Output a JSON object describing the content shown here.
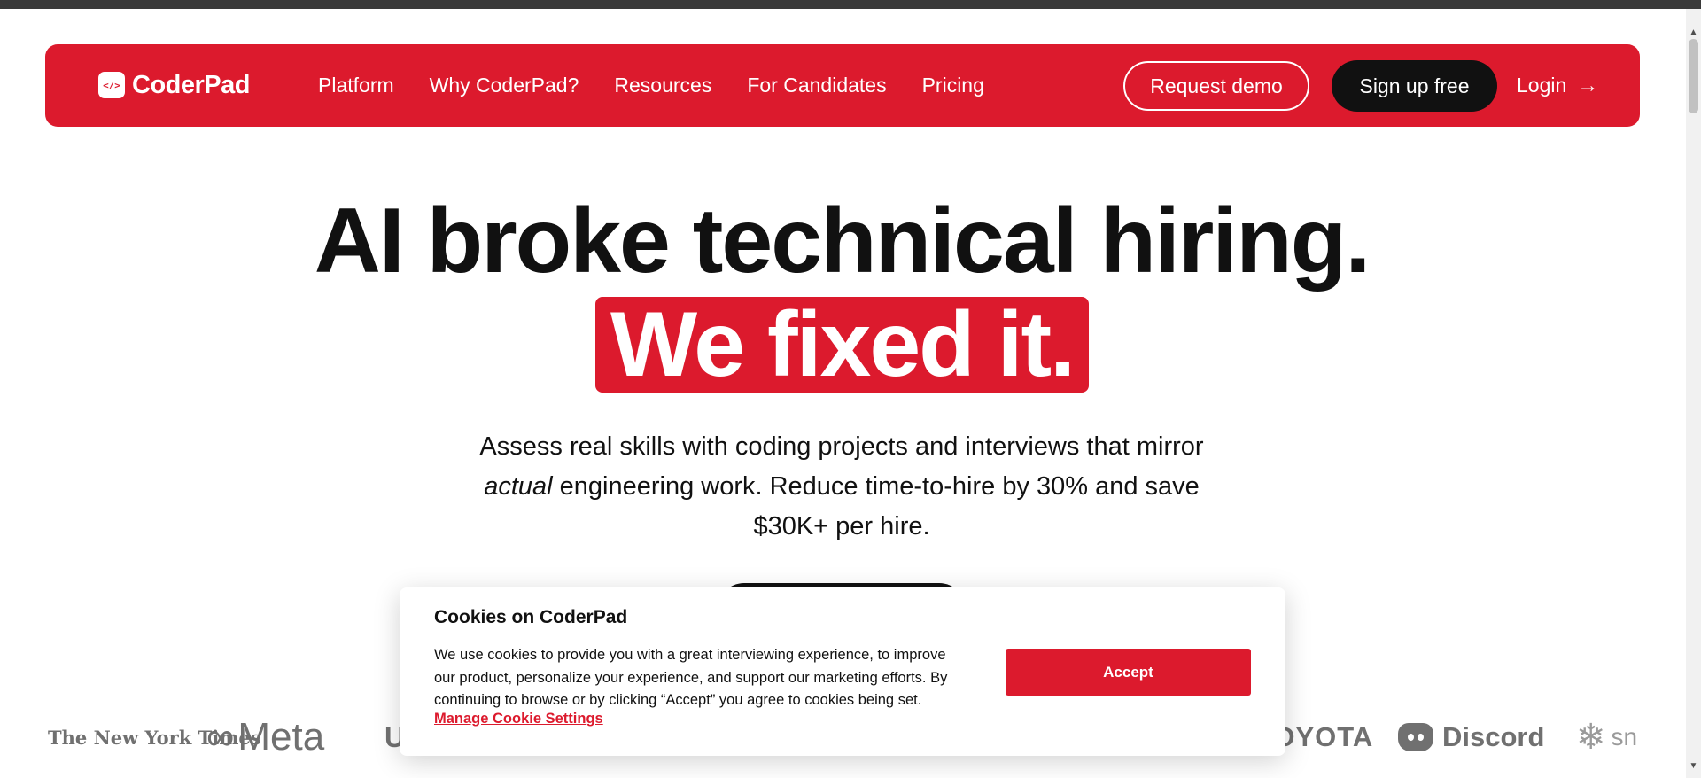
{
  "nav": {
    "logo_mark": "</>",
    "logo_text": "CoderPad",
    "links": [
      "Platform",
      "Why CoderPad?",
      "Resources",
      "For Candidates",
      "Pricing"
    ],
    "request_demo": "Request demo",
    "signup": "Sign up free",
    "login": "Login",
    "login_arrow": "→"
  },
  "hero": {
    "line1": "AI broke technical hiring.",
    "line2": "We fixed it.",
    "subtitle_part1": "Assess real skills with coding projects and interviews that mirror ",
    "subtitle_emphasis": "actual",
    "subtitle_part2": " engineering work. Reduce time-to-hire by 30% and save $30K+ per hire."
  },
  "logos": {
    "nyt": "The New York Times",
    "meta": "Meta",
    "partial_u": "U",
    "toyota": "TOYOTA",
    "discord": "Discord",
    "snowflake_partial": "sn"
  },
  "cookie": {
    "title": "Cookies on CoderPad",
    "text": "We use cookies to provide you with a great interviewing experience, to improve our product, personalize your experience, and support our marketing efforts. By continuing to browse or by clicking “Accept” you agree to cookies being set.",
    "manage_link": "Manage Cookie Settings",
    "accept": "Accept"
  },
  "colors": {
    "brand_red": "#dc1a2d",
    "dark": "#111111",
    "logo_gray": "#707070"
  }
}
